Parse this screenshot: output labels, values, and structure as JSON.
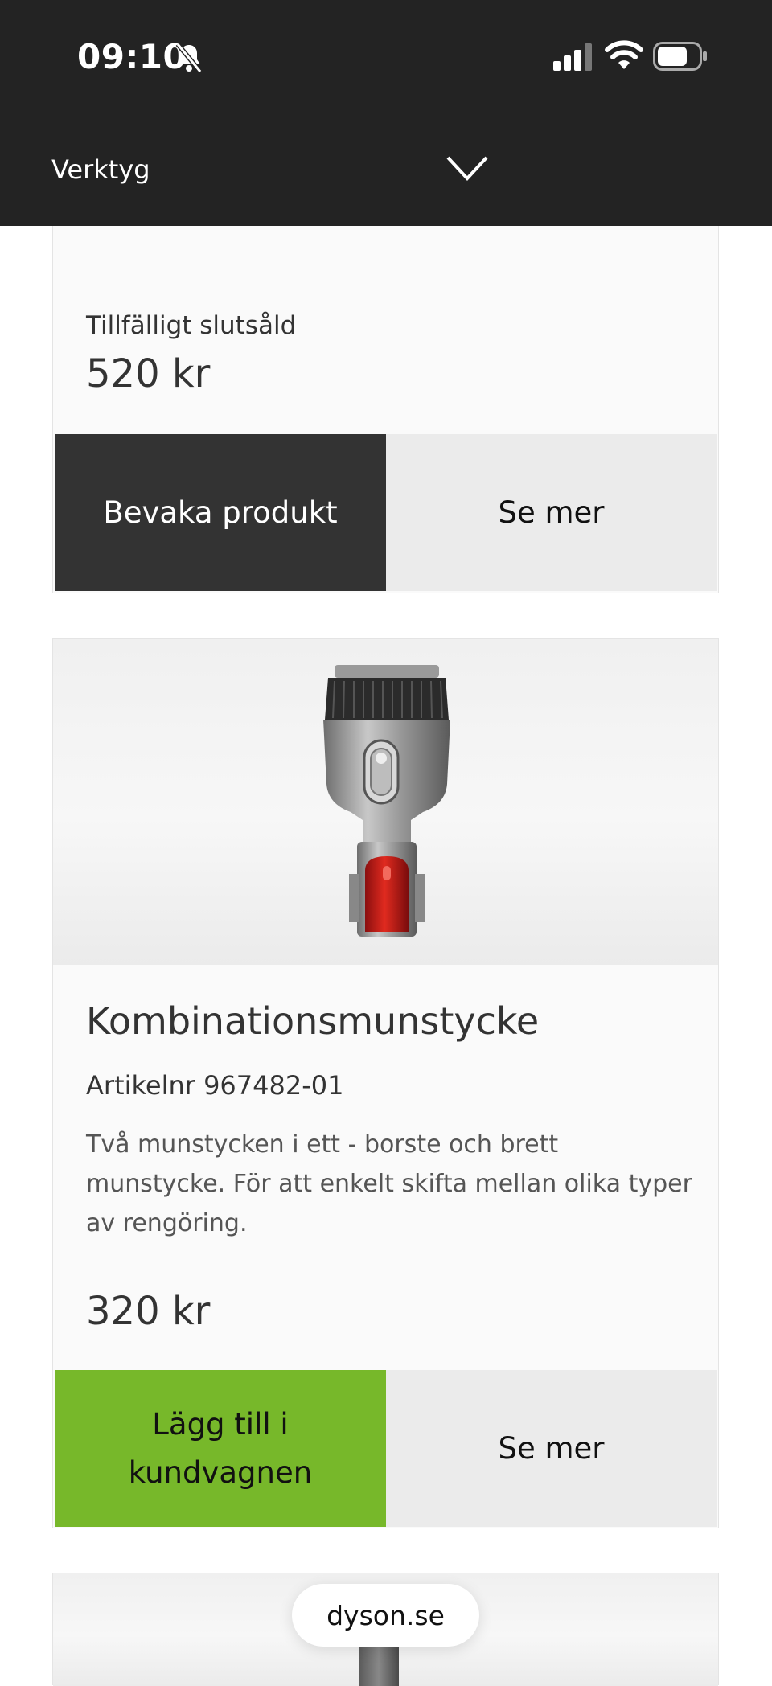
{
  "status_bar": {
    "time": "09:10",
    "icons": [
      "bell-slash-icon",
      "signal-icon",
      "wifi-icon",
      "battery-icon"
    ]
  },
  "nav": {
    "category": "Verktyg",
    "dropdown_icon": "chevron-down-icon"
  },
  "products": [
    {
      "stock_status": "Tillfälligt slutsåld",
      "price": "520 kr",
      "primary_button": "Bevaka produkt",
      "secondary_button": "Se mer"
    },
    {
      "title": "Kombinationsmunstycke",
      "article": "Artikelnr 967482-01",
      "description": "Två munstycken i ett - borste och brett munstycke. För att enkelt skifta mellan olika typer av rengöring.",
      "price": "320 kr",
      "primary_button": "Lägg till i kundvagnen",
      "secondary_button": "Se mer"
    }
  ],
  "browser": {
    "url": "dyson.se"
  },
  "colors": {
    "header_bg": "#232323",
    "dark_button": "#333333",
    "add_to_cart": "#77b82a",
    "light_button": "#ebebeb"
  }
}
